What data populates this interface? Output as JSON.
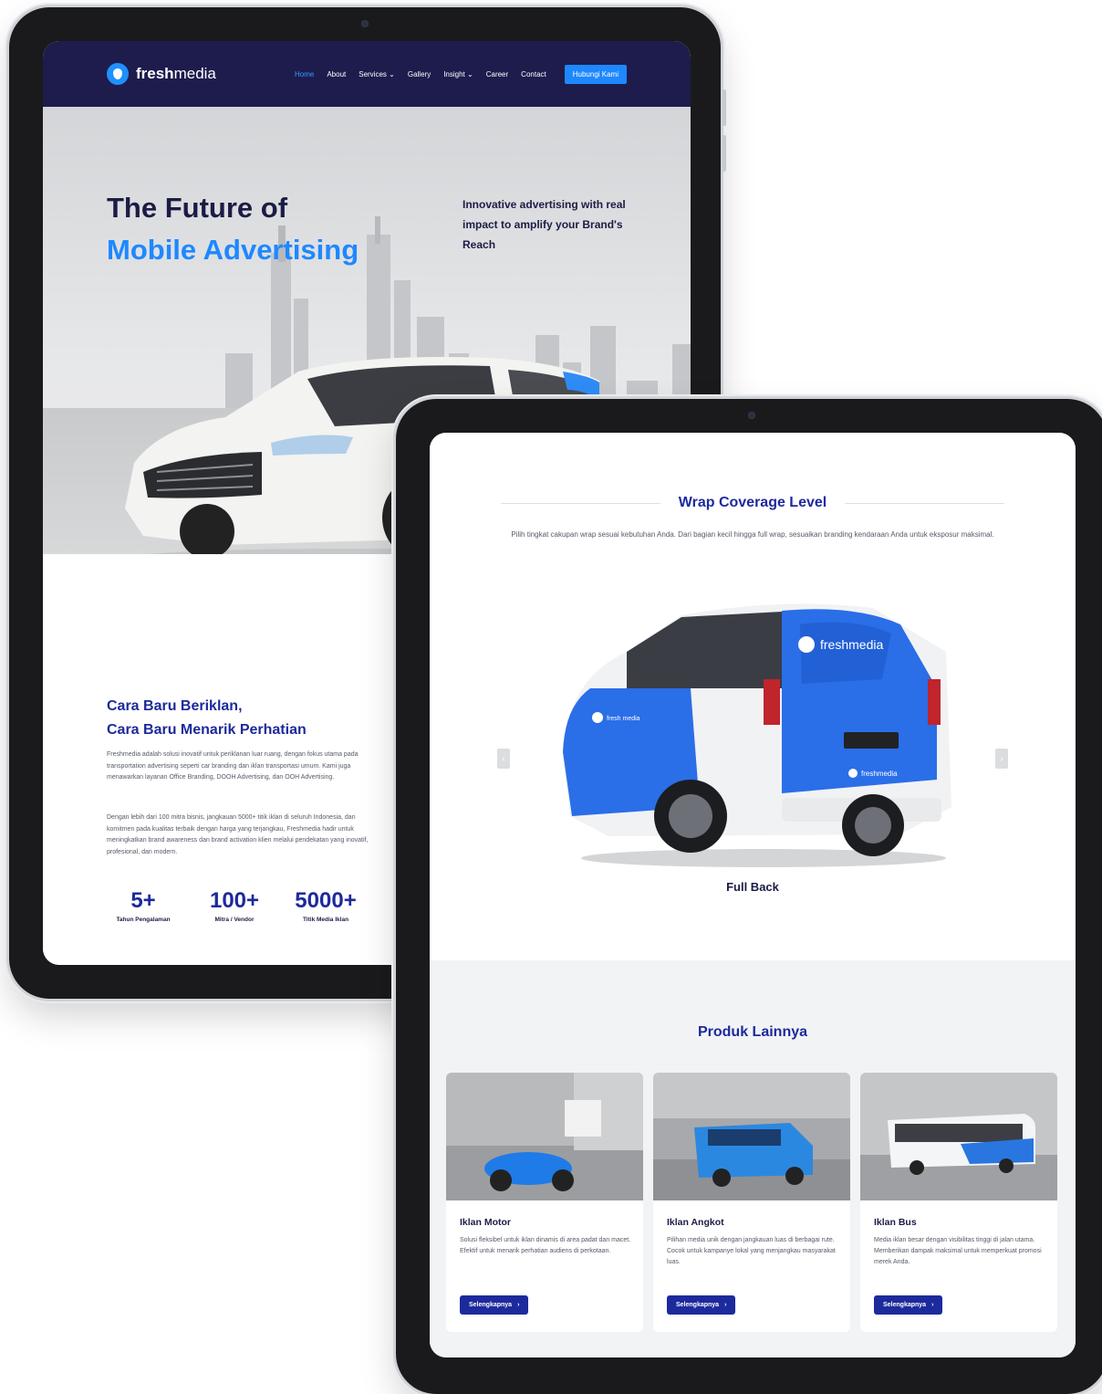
{
  "screen1": {
    "nav": {
      "logo_text_bold": "fresh",
      "logo_text_light": "media",
      "links": [
        "Home",
        "About",
        "Services",
        "Gallery",
        "Insight",
        "Career",
        "Contact"
      ],
      "cta": "Hubungi Kami"
    },
    "hero": {
      "title_line1": "The Future of",
      "title_line2": "Mobile Advertising",
      "subtitle": "Innovative advertising with real impact to amplify your Brand's Reach"
    },
    "about": {
      "heading_line1": "Cara Baru Beriklan,",
      "heading_line2": "Cara Baru Menarik Perhatian",
      "paragraph1": "Freshmedia adalah solusi inovatif untuk periklanan luar ruang, dengan fokus utama pada transportation advertising seperti car branding dan iklan transportasi umum. Kami juga menawarkan layanan Office Branding, DOOH Advertising, dan OOH Advertising.",
      "paragraph2": "Dengan lebih dari 100 mitra bisnis, jangkauan 5000+ titik iklan di seluruh Indonesia, dan komitmen pada kualitas terbaik dengan harga yang terjangkau, Freshmedia hadir untuk meningkatkan brand awareness dan brand activation klien melalui pendekatan yang inovatif, profesional, dan modern.",
      "stats": [
        {
          "value": "5+",
          "label": "Tahun Pengalaman"
        },
        {
          "value": "100+",
          "label": "Mitra / Vendor"
        },
        {
          "value": "5000+",
          "label": "Titik Media Iklan"
        }
      ]
    }
  },
  "screen2": {
    "wrap": {
      "heading": "Wrap Coverage Level",
      "description": "Pilih tingkat cakupan wrap sesuai kebutuhan Anda. Dari bagian kecil hingga full wrap, sesuaikan branding kendaraan Anda untuk eksposur maksimal.",
      "caption": "Full Back",
      "prev": "‹",
      "next": "›",
      "brand_rear": "freshmedia",
      "brand_side": "fresh media",
      "brand_bumper": "freshmedia"
    },
    "produk": {
      "heading": "Produk Lainnya",
      "cards": [
        {
          "title": "Iklan Motor",
          "text": "Solusi fleksibel untuk iklan dinamis di area padat dan macet. Efektif untuk menarik perhatian audiens di perkotaan.",
          "button": "Selengkapnya"
        },
        {
          "title": "Iklan Angkot",
          "text": "Pilihan media unik dengan jangkauan luas di berbagai rute. Cocok untuk kampanye lokal yang menjangkau masyarakat luas.",
          "button": "Selengkapnya"
        },
        {
          "title": "Iklan Bus",
          "text": "Media iklan besar dengan visibilitas tinggi di jalan utama. Memberikan dampak maksimal untuk memperkuat promosi merek Anda.",
          "button": "Selengkapnya"
        }
      ]
    }
  },
  "colors": {
    "navy": "#1d1c4d",
    "brand_blue": "#1e88ff",
    "heading_blue": "#1d2a9c"
  }
}
